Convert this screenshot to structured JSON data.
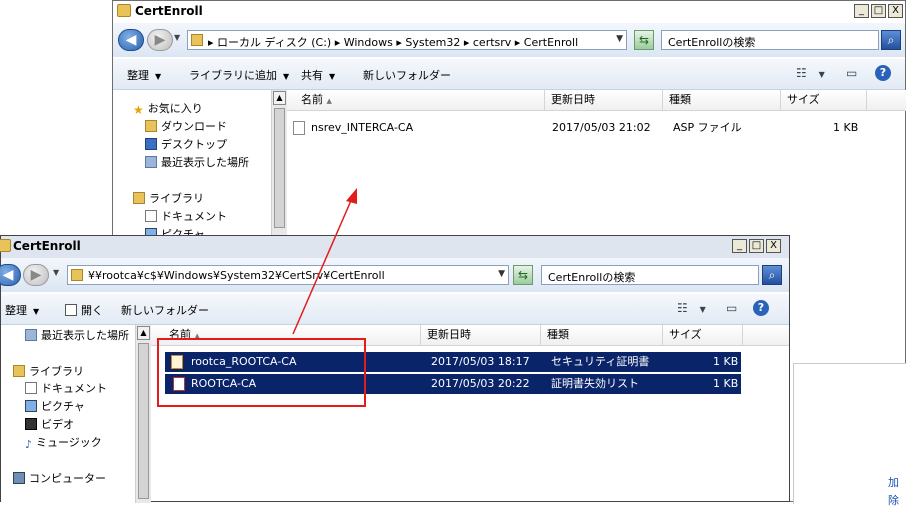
{
  "back_window": {
    "title": "CertEnroll",
    "controls": {
      "minimize": "_",
      "maximize": "□",
      "close": "X"
    },
    "address_path": "▸ ローカル ディスク (C:) ▸ Windows ▸ System32 ▸ certsrv ▸ CertEnroll",
    "search_placeholder": "CertEnrollの検索",
    "toolbar": {
      "organize": "整理",
      "add_to_library": "ライブラリに追加",
      "share": "共有",
      "new_folder": "新しいフォルダー"
    },
    "nav": {
      "favorites": "お気に入り",
      "downloads": "ダウンロード",
      "desktop": "デスクトップ",
      "recent": "最近表示した場所",
      "libraries": "ライブラリ",
      "documents": "ドキュメント",
      "pictures": "ピクチャ"
    },
    "columns": {
      "name": "名前",
      "date": "更新日時",
      "type": "種類",
      "size": "サイズ"
    },
    "files": [
      {
        "name": "nsrev_INTERCA-CA",
        "date": "2017/05/03 21:02",
        "type": "ASP ファイル",
        "size": "1 KB"
      }
    ]
  },
  "front_window": {
    "title": "CertEnroll",
    "controls": {
      "minimize": "_",
      "maximize": "□",
      "close": "X"
    },
    "address_path": "¥¥rootca¥c$¥Windows¥System32¥CertSrv¥CertEnroll",
    "search_placeholder": "CertEnrollの検索",
    "toolbar": {
      "organize": "整理",
      "open": "開く",
      "new_folder": "新しいフォルダー"
    },
    "nav": {
      "recent": "最近表示した場所",
      "libraries": "ライブラリ",
      "documents": "ドキュメント",
      "pictures": "ピクチャ",
      "videos": "ビデオ",
      "music": "ミュージック",
      "computer": "コンピューター"
    },
    "columns": {
      "name": "名前",
      "date": "更新日時",
      "type": "種類",
      "size": "サイズ"
    },
    "files": [
      {
        "name": "rootca_ROOTCA-CA",
        "date": "2017/05/03 18:17",
        "type": "セキュリティ証明書",
        "size": "1 KB"
      },
      {
        "name": "ROOTCA-CA",
        "date": "2017/05/03 20:22",
        "type": "証明書失効リスト",
        "size": "1 KB"
      }
    ]
  },
  "colors": {
    "annotation": "#e31b1b",
    "selection": "#0a246a"
  },
  "partial_right_text": [
    "加",
    "除"
  ]
}
